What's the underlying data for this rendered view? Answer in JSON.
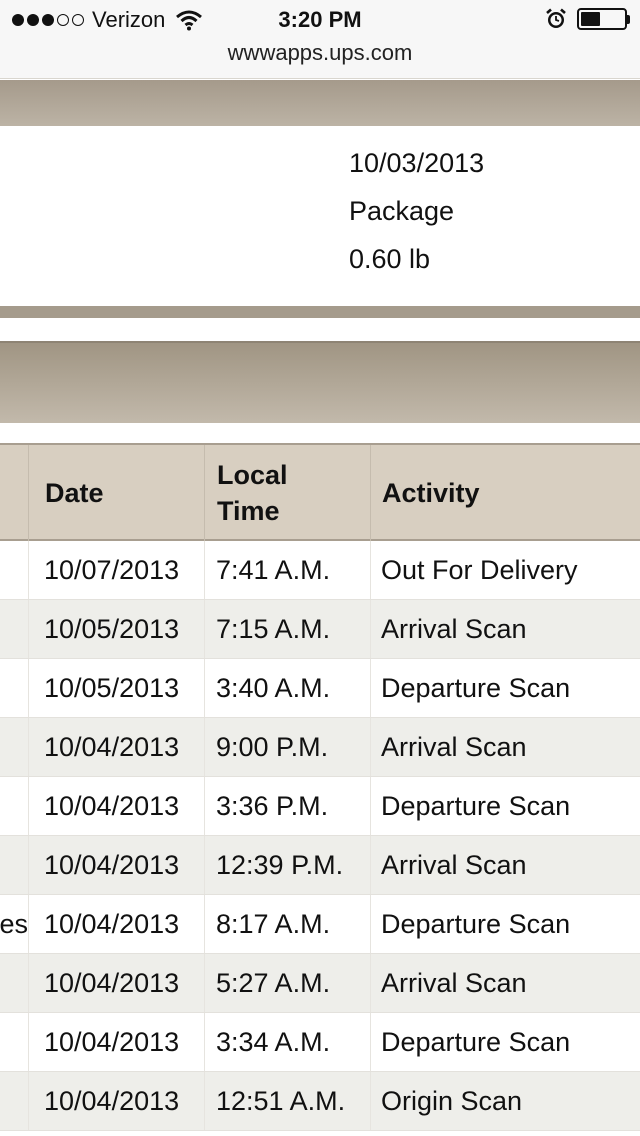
{
  "status_bar": {
    "carrier": "Verizon",
    "time": "3:20 PM",
    "signal_bars_filled": 3,
    "signal_bars_total": 5,
    "battery_level": 0.45
  },
  "browser": {
    "url": "wwwapps.ups.com"
  },
  "package_details": {
    "ship_date": "10/03/2013",
    "type": "Package",
    "weight": "0.60 lb"
  },
  "activity_table": {
    "headers": {
      "date": "Date",
      "local_time_line1": "Local",
      "local_time_line2": "Time",
      "activity": "Activity"
    },
    "rows": [
      {
        "location": "",
        "date": "10/07/2013",
        "time": "7:41 A.M.",
        "activity": "Out For Delivery"
      },
      {
        "location": "",
        "date": "10/05/2013",
        "time": "7:15 A.M.",
        "activity": "Arrival Scan"
      },
      {
        "location": "",
        "date": "10/05/2013",
        "time": "3:40 A.M.",
        "activity": "Departure Scan"
      },
      {
        "location": "",
        "date": "10/04/2013",
        "time": "9:00 P.M.",
        "activity": "Arrival Scan"
      },
      {
        "location": "",
        "date": "10/04/2013",
        "time": "3:36 P.M.",
        "activity": "Departure Scan"
      },
      {
        "location": "",
        "date": "10/04/2013",
        "time": "12:39 P.M.",
        "activity": "Arrival Scan"
      },
      {
        "location": "es",
        "date": "10/04/2013",
        "time": "8:17 A.M.",
        "activity": "Departure Scan"
      },
      {
        "location": "",
        "date": "10/04/2013",
        "time": "5:27 A.M.",
        "activity": "Arrival Scan"
      },
      {
        "location": "",
        "date": "10/04/2013",
        "time": "3:34 A.M.",
        "activity": "Departure Scan"
      },
      {
        "location": "",
        "date": "10/04/2013",
        "time": "12:51 A.M.",
        "activity": "Origin Scan"
      }
    ]
  },
  "icons": {
    "wifi": "wifi-icon",
    "alarm": "alarm-clock-icon",
    "battery": "battery-icon"
  }
}
